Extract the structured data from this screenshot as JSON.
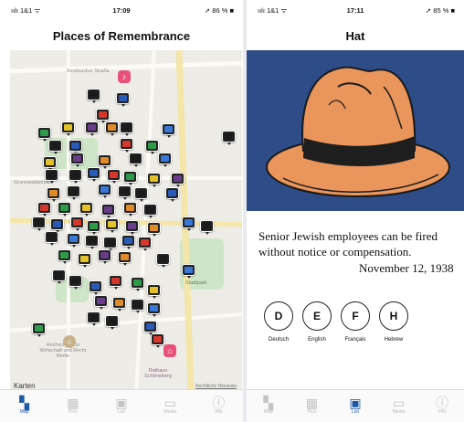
{
  "left_screen": {
    "status": {
      "signal": "ıılı 1&1 ᯤ",
      "time": "17:09",
      "battery": "➚ 86 % ■"
    },
    "title": "Places of Remembrance",
    "map": {
      "street_labels": [
        "Innsbrucker Straße",
        "Grunewaldstraße",
        "Hochschule für Wirtschaft und Recht Berlin",
        "Rathaus Schöneberg",
        "Stadtpark"
      ],
      "attribution": "Karten",
      "legal_link": "Rechtliche Hinweise"
    },
    "tabs": [
      {
        "label": "Map",
        "icon": "map-icon",
        "active": true
      },
      {
        "label": "Pics",
        "icon": "pictures-icon",
        "active": false
      },
      {
        "label": "List",
        "icon": "list-icon",
        "active": false
      },
      {
        "label": "Media",
        "icon": "media-icon",
        "active": false
      },
      {
        "label": "Info",
        "icon": "info-icon",
        "active": false
      }
    ]
  },
  "right_screen": {
    "status": {
      "signal": "ıılı 1&1 ᯤ",
      "time": "17:11",
      "battery": "➚ 85 % ■"
    },
    "title": "Hat",
    "story_line1": "Senior Jewish employees can be fired",
    "story_line2": "without notice or compensation.",
    "date": "November 12, 1938",
    "languages": [
      {
        "letter": "D",
        "label": "Deutsch"
      },
      {
        "letter": "E",
        "label": "English"
      },
      {
        "letter": "F",
        "label": "Français"
      },
      {
        "letter": "H",
        "label": "Hebrew"
      }
    ],
    "tabs": [
      {
        "label": "Map",
        "icon": "map-icon",
        "active": false
      },
      {
        "label": "Pics",
        "icon": "pictures-icon",
        "active": false
      },
      {
        "label": "List",
        "icon": "list-icon",
        "active": true
      },
      {
        "label": "Media",
        "icon": "media-icon",
        "active": false
      },
      {
        "label": "Info",
        "icon": "info-icon",
        "active": false
      }
    ]
  },
  "colors": {
    "tab_active": "#1f5aa6",
    "hat_background": "#2e4d88",
    "hat_color": "#e9955b"
  }
}
